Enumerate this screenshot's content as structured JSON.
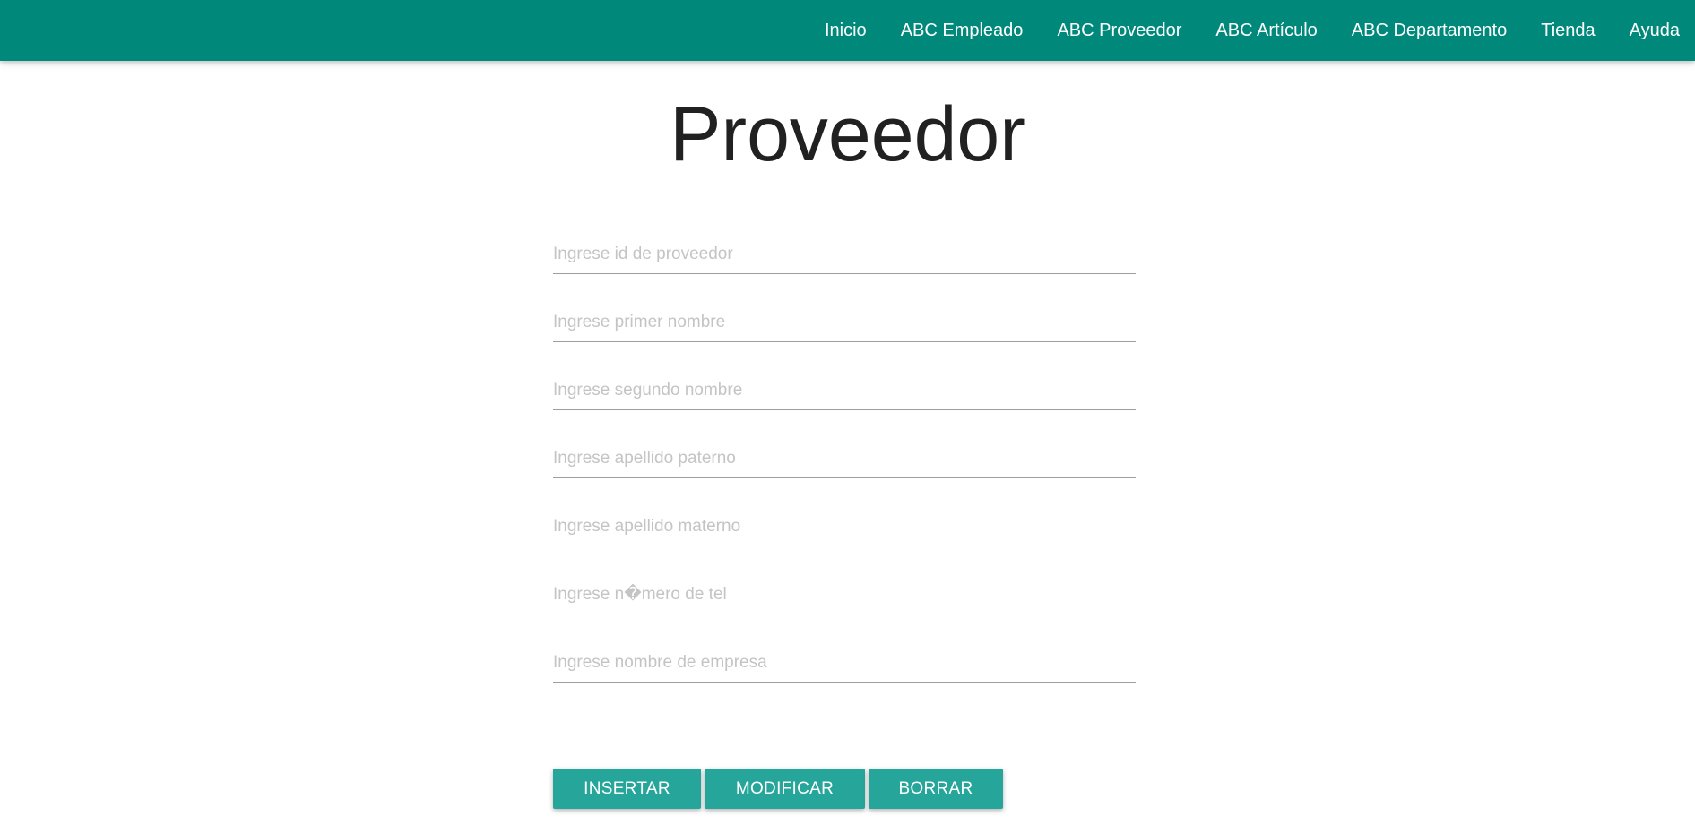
{
  "nav": {
    "items": [
      {
        "label": "Inicio"
      },
      {
        "label": "ABC Empleado"
      },
      {
        "label": "ABC Proveedor"
      },
      {
        "label": "ABC Artículo"
      },
      {
        "label": "ABC Departamento"
      },
      {
        "label": "Tienda"
      },
      {
        "label": "Ayuda"
      }
    ]
  },
  "page": {
    "title": "Proveedor"
  },
  "form": {
    "fields": [
      {
        "placeholder": "Ingrese id de proveedor",
        "value": ""
      },
      {
        "placeholder": "Ingrese primer nombre",
        "value": ""
      },
      {
        "placeholder": "Ingrese segundo nombre",
        "value": ""
      },
      {
        "placeholder": "Ingrese apellido paterno",
        "value": ""
      },
      {
        "placeholder": "Ingrese apellido materno",
        "value": ""
      },
      {
        "placeholder": "Ingrese n�mero de tel",
        "value": ""
      },
      {
        "placeholder": "Ingrese nombre de empresa",
        "value": ""
      }
    ]
  },
  "buttons": {
    "insert": "INSERTAR",
    "modify": "MODIFICAR",
    "delete": "BORRAR"
  },
  "colors": {
    "navbar": "#00897b",
    "button": "#26a69a",
    "title": "#212121",
    "placeholder": "#c4c4c4",
    "underline": "#9e9e9e"
  }
}
